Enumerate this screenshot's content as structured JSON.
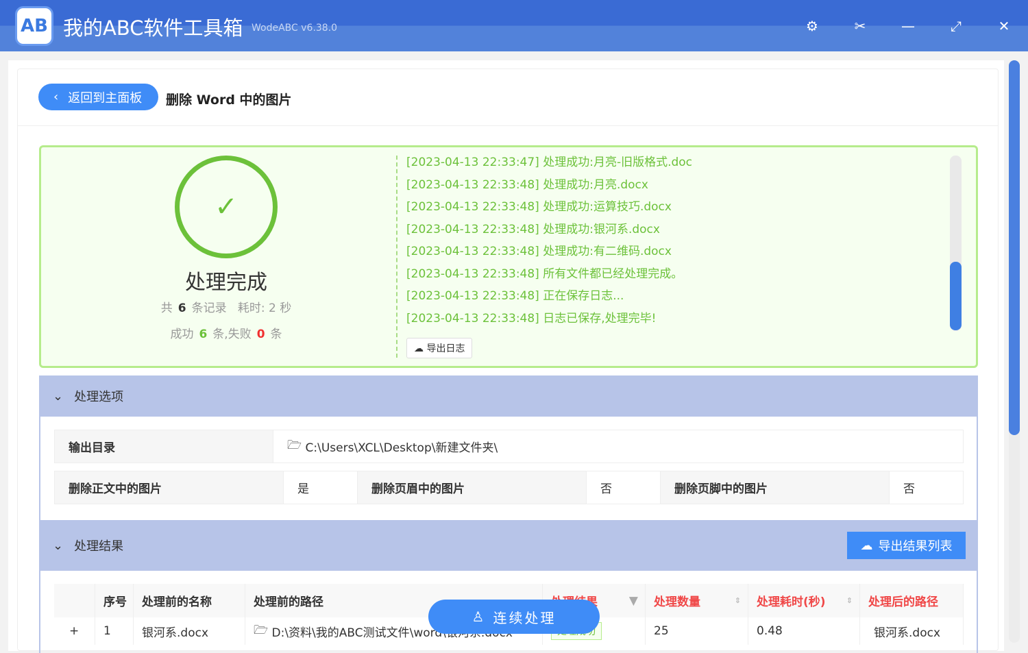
{
  "app": {
    "title": "我的ABC软件工具箱",
    "version": "WodeABC v6.38.0",
    "logo": "AB"
  },
  "header": {
    "back": "返回到主面板",
    "title": "删除 Word 中的图片"
  },
  "summary": {
    "status": "处理完成",
    "total_prefix": "共",
    "total": "6",
    "total_suffix": "条记录",
    "time_label": "耗时:",
    "time": "2 秒",
    "success_prefix": "成功",
    "success": "6",
    "success_suffix": "条,失败",
    "fail": "0",
    "fail_suffix": "条"
  },
  "log": [
    "[2023-04-13 22:33:47] 处理成功:月亮-旧版格式.doc",
    "[2023-04-13 22:33:48] 处理成功:月亮.docx",
    "[2023-04-13 22:33:48] 处理成功:运算技巧.docx",
    "[2023-04-13 22:33:48] 处理成功:银河系.docx",
    "[2023-04-13 22:33:48] 处理成功:有二维码.docx",
    "[2023-04-13 22:33:48] 所有文件都已经处理完成。",
    "[2023-04-13 22:33:48] 正在保存日志...",
    "[2023-04-13 22:33:48] 日志已保存,处理完毕!"
  ],
  "export_log": "导出日志",
  "options": {
    "title": "处理选项",
    "output_label": "输出目录",
    "output": "C:\\Users\\XCL\\Desktop\\新建文件夹\\",
    "body_label": "删除正文中的图片",
    "body": "是",
    "header_label": "删除页眉中的图片",
    "header": "否",
    "footer_label": "删除页脚中的图片",
    "footer": "否"
  },
  "results": {
    "title": "处理结果",
    "export": "导出结果列表",
    "columns": [
      "序号",
      "处理前的名称",
      "处理前的路径",
      "处理结果",
      "处理数量",
      "处理耗时(秒)",
      "处理后的路径"
    ],
    "rows": [
      {
        "index": "1",
        "name": "银河系.docx",
        "path": "D:\\资料\\我的ABC测试文件\\word\\银河系.docx",
        "result": "处理成功",
        "count": "25",
        "time": "0.48",
        "out": "银河系.docx"
      }
    ]
  },
  "fab": "连续处理"
}
